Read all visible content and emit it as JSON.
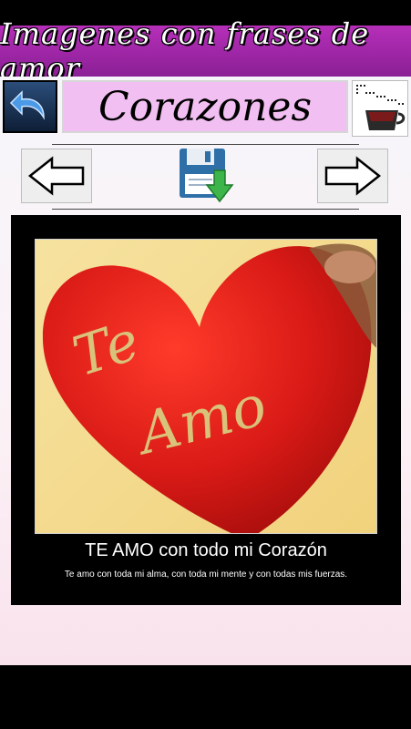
{
  "app": {
    "title": "Imagenes con frases de amor"
  },
  "toolbar": {
    "category": "Corazones"
  },
  "poster": {
    "photo_text_line1": "Te",
    "photo_text_line2": "Amo",
    "caption_title": "TE AMO con todo mi Corazón",
    "caption_subtitle": "Te amo con toda mi alma, con toda mi mente y con todas mis fuerzas."
  },
  "colors": {
    "header": "#a52aad",
    "category_bg": "#f2bff2",
    "heart": "#e0201d"
  },
  "icons": {
    "back": "undo-arrow-icon",
    "cup": "coffee-cup-icon",
    "prev": "arrow-left-icon",
    "next": "arrow-right-icon",
    "save": "floppy-download-icon"
  }
}
